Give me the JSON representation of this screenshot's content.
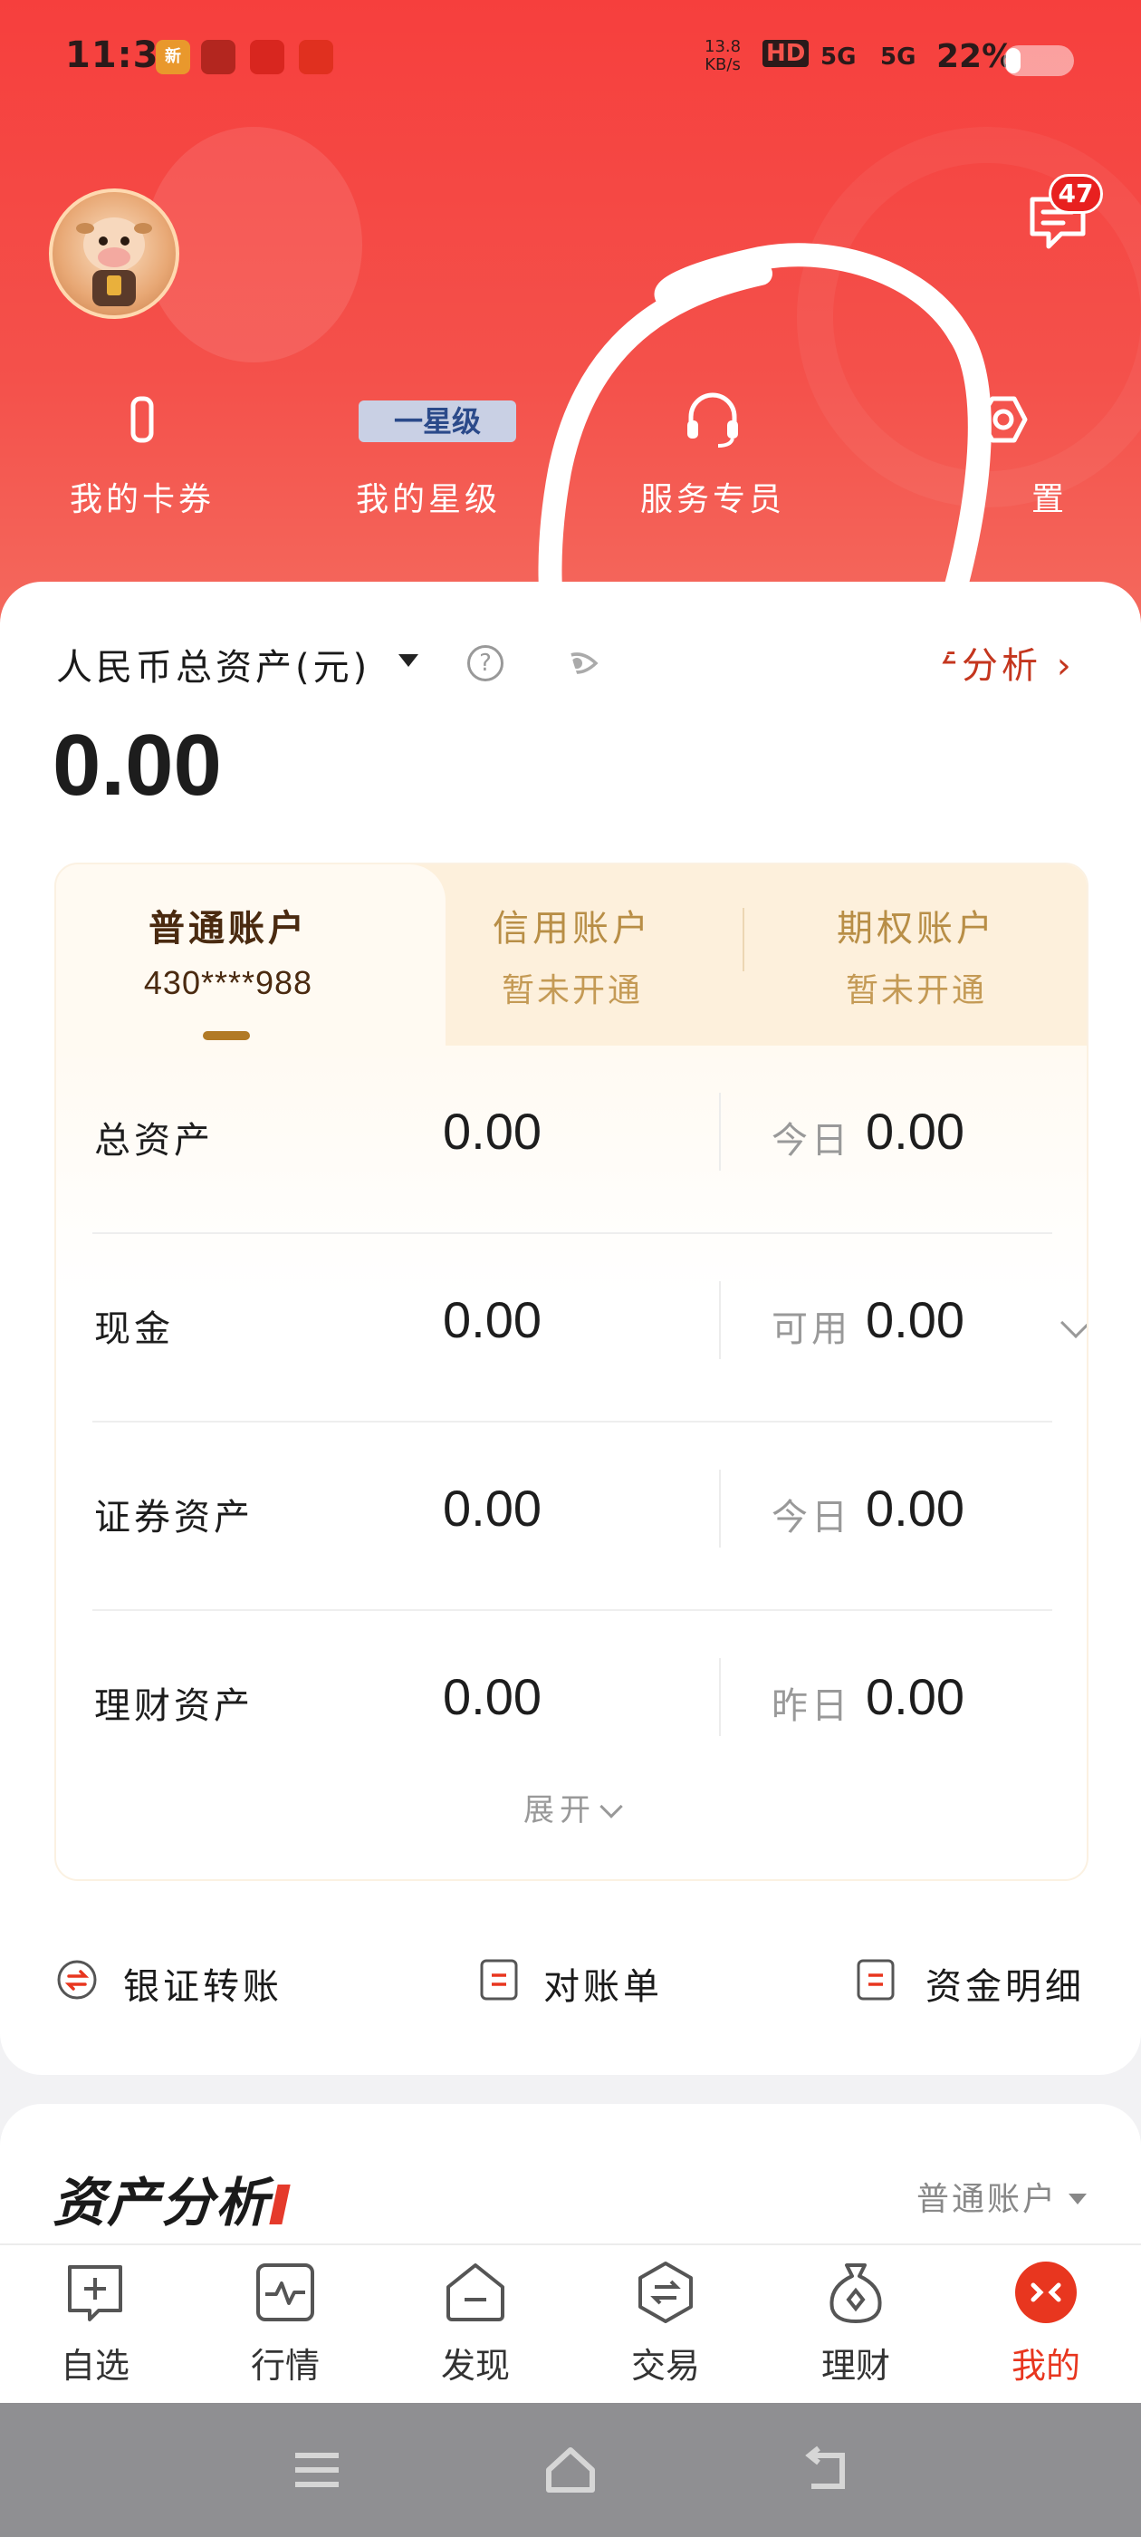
{
  "status_bar": {
    "time": "11:32",
    "apps": [
      "新",
      "",
      "",
      ""
    ],
    "net_speed_value": "13.8",
    "net_speed_unit": "KB/s",
    "hd": "HD",
    "sim1": "5G",
    "sim2": "5G",
    "battery_percent": "22%",
    "battery_level": 0.22
  },
  "header": {
    "message_badge": "47",
    "star_level": "一星级",
    "nav_items": [
      {
        "label": "我的卡券",
        "icon": "card-icon"
      },
      {
        "label": "我的星级",
        "icon": "star-icon"
      },
      {
        "label": "服务专员",
        "icon": "headset-icon"
      },
      {
        "label": "置",
        "icon": "settings-icon"
      }
    ]
  },
  "assets": {
    "total_label": "人民币总资产(元)",
    "analysis_link": "产分析",
    "total_value": "0.00"
  },
  "account_tabs": [
    {
      "title": "普通账户",
      "sub": "430****988",
      "active": true
    },
    {
      "title": "信用账户",
      "sub": "暂未开通",
      "active": false
    },
    {
      "title": "期权账户",
      "sub": "暂未开通",
      "active": false
    }
  ],
  "rows": [
    {
      "label": "总资产",
      "value": "0.00",
      "sublabel": "今日",
      "subvalue": "0.00"
    },
    {
      "label": "现金",
      "value": "0.00",
      "sublabel": "可用",
      "subvalue": "0.00"
    },
    {
      "label": "证券资产",
      "value": "0.00",
      "sublabel": "今日",
      "subvalue": "0.00"
    },
    {
      "label": "理财资产",
      "value": "0.00",
      "sublabel": "昨日",
      "subvalue": "0.00"
    }
  ],
  "expand_label": "展开",
  "quick_actions": [
    {
      "label": "银证转账",
      "icon": "transfer-icon"
    },
    {
      "label": "对账单",
      "icon": "statement-icon"
    },
    {
      "label": "资金明细",
      "icon": "funds-detail-icon"
    }
  ],
  "analysis_section": {
    "title": "资产分析",
    "account_selector": "普通账户"
  },
  "tabbar": [
    {
      "label": "自选",
      "icon": "watchlist-icon",
      "active": false
    },
    {
      "label": "行情",
      "icon": "market-icon",
      "active": false
    },
    {
      "label": "发现",
      "icon": "discover-icon",
      "active": false
    },
    {
      "label": "交易",
      "icon": "trade-icon",
      "active": false
    },
    {
      "label": "理财",
      "icon": "wealth-icon",
      "active": false
    },
    {
      "label": "我的",
      "icon": "profile-icon",
      "active": true
    }
  ],
  "colors": {
    "header_red": "#f63f3d",
    "accent_red": "#e8361f",
    "gold": "#b17a26"
  }
}
